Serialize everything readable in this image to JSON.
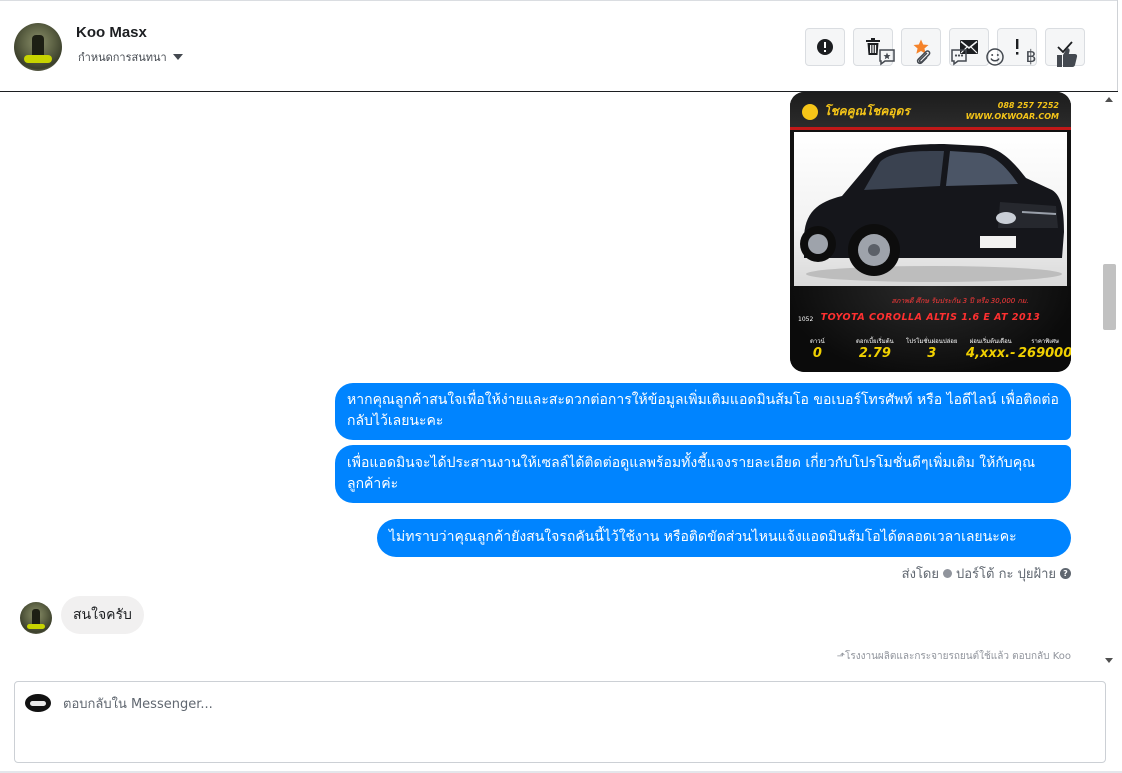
{
  "conversation": {
    "name": "Koo Masx",
    "assign_label": "กำหนดการสนทนา"
  },
  "actions": [
    {
      "name": "mark-spam-button",
      "icon": "alert-circle-icon"
    },
    {
      "name": "delete-button",
      "icon": "trash-icon"
    },
    {
      "name": "star-button",
      "icon": "star-icon"
    },
    {
      "name": "mark-unread-button",
      "icon": "envelope-icon"
    },
    {
      "name": "follow-up-button",
      "icon": "exclamation-icon"
    },
    {
      "name": "mark-done-button",
      "icon": "check-icon"
    }
  ],
  "car_image": {
    "brand": "โชคคูณโชคอุดร",
    "phone": "088 257 7252",
    "website": "WWW.OKWOAR.COM",
    "caption": "สภาพดี ศึกษ รับประกัน 3 ปี หรือ 30,000 กม.",
    "code": "1052",
    "model": "TOYOTA COROLLA ALTIS 1.6 E AT 2013",
    "specs": [
      {
        "label": "ดาวน์",
        "value": "0"
      },
      {
        "label": "ดอกเบี้ยเริ่มต้น",
        "value": "2.79"
      },
      {
        "label": "โปรโมชั่นผ่อนปล่อย",
        "value": "3"
      },
      {
        "label": "ผ่อนเริ่มต้นเดือน",
        "value": "4,xxx.-"
      },
      {
        "label": "ราคาพิเศษ",
        "value": "269000"
      }
    ]
  },
  "messages": {
    "outgoing": [
      "หากคุณลูกค้าสนใจเพื่อให้ง่ายและสะดวกต่อการให้ข้อมูลเพิ่มเติมแอดมินส้มโอ ขอเบอร์โทรศัพท์ หรือ ไอดีไลน์ เพื่อติดต่อกลับไว้เลยนะคะ",
      "เพื่อแอดมินจะได้ประสานงานให้เซลล์ได้ติดต่อดูแลพร้อมทั้งชี้แจงรายละเอียด เกี่ยวกับโปรโมชั่นดีๆเพิ่มเติม ให้กับคุณลูกค้าค่ะ",
      "ไม่ทราบว่าคุณลูกค้ายังสนใจรถคันนี้ไว้ใช้งาน หรือติดขัดส่วนไหนแจ้งแอดมินส้มโอได้ตลอดเวลาเลยนะคะ"
    ],
    "sent_by_label": "ส่งโดย",
    "sent_by_name": "ปอร์โต้ กะ ปุยฝ้าย",
    "incoming": "สนใจครับ",
    "reply_note": "โรงงานผลิตและกระจายรถยนต์ใช้แล้ว ตอบกลับ Koo"
  },
  "composer": {
    "placeholder": "ตอบกลับใน Messenger..."
  },
  "composer_tools": [
    {
      "name": "saved-replies-icon"
    },
    {
      "name": "attachment-icon"
    },
    {
      "name": "chat-bubble-icon"
    },
    {
      "name": "emoji-icon"
    },
    {
      "name": "baht-payment-icon",
      "glyph": "฿"
    },
    {
      "name": "thumbs-up-icon"
    }
  ],
  "colors": {
    "accent": "#0084ff",
    "star": "#f5832a",
    "incoming_bubble": "#f1f0f0"
  }
}
